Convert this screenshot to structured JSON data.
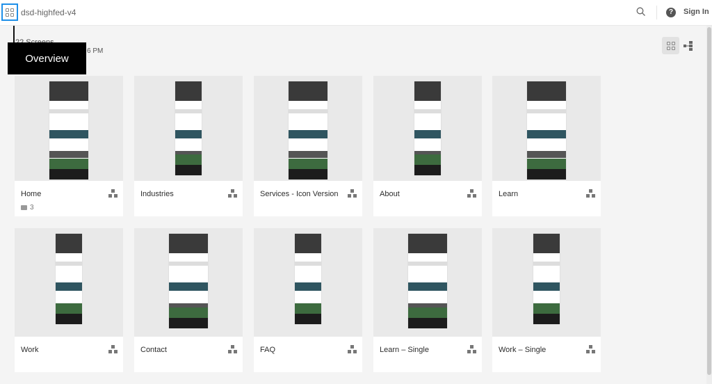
{
  "header": {
    "title": "dsd-highfed-v4",
    "sign_in": "Sign In",
    "help_icon": "?"
  },
  "summary": {
    "screens": "22 Screens",
    "time": "6 PM"
  },
  "tooltip": "Overview",
  "colors": {
    "accent": "#1e8fe8",
    "tooltip_bg": "#000000"
  },
  "screens": [
    {
      "name": "Home",
      "comments": "3"
    },
    {
      "name": "Industries"
    },
    {
      "name": "Services - Icon Version"
    },
    {
      "name": "About"
    },
    {
      "name": "Learn"
    },
    {
      "name": "Work"
    },
    {
      "name": "Contact"
    },
    {
      "name": "FAQ"
    },
    {
      "name": "Learn – Single"
    },
    {
      "name": "Work – Single"
    }
  ]
}
